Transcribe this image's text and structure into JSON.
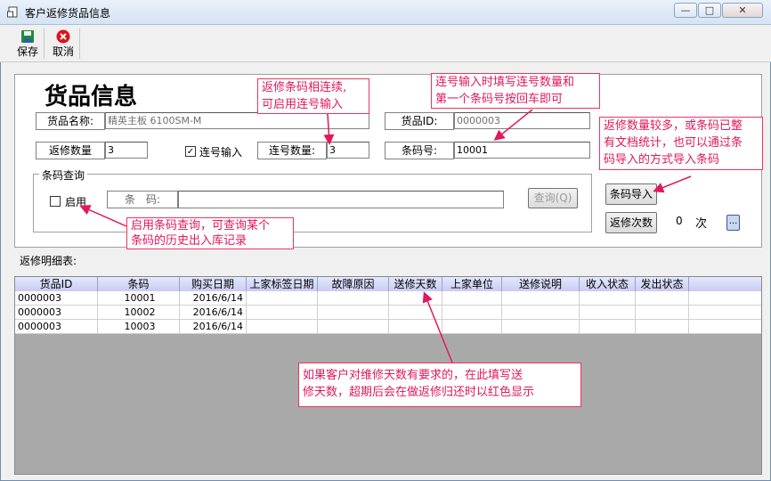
{
  "window": {
    "title": "客户返修货品信息",
    "minimize": "—",
    "maximize": "□",
    "close": "✕"
  },
  "toolbar": {
    "save_label": "保存",
    "cancel_label": "取消"
  },
  "form": {
    "heading": "货品信息",
    "product_name_label": "货品名称:",
    "product_name_value": "精英主板 6100SM-M",
    "product_id_label": "货品ID:",
    "product_id_value": "0000003",
    "repair_qty_label": "返修数量",
    "repair_qty_value": "3",
    "serial_input_label": "连号输入",
    "serial_qty_label": "连号数量:",
    "serial_qty_value": "3",
    "barcode_label": "条码号:",
    "barcode_value": "10001",
    "barcode_query_title": "条码查询",
    "enable_label": "启用",
    "query_barcode_label": "条　码:",
    "query_barcode_value": "",
    "query_button": "查询(Q)",
    "barcode_import_button": "条码导入",
    "repair_times_button": "返修次数",
    "repair_times_value": "0",
    "repair_times_unit": "次",
    "more_button": "..."
  },
  "notes": {
    "n1_line1": "返修条码相连续,",
    "n1_line2": "可启用连号输入",
    "n2_line1": "连号输入时填写连号数量和",
    "n2_line2": "第一个条码号按回车即可",
    "n3_line1": "返修数量较多，或条码已整",
    "n3_line2": "有文档统计，也可以通过条",
    "n3_line3": "码导入的方式导入条码",
    "n4_line1": "启用条码查询，可查询某个",
    "n4_line2": "条码的历史出入库记录",
    "n5_line1": "如果客户对维修天数有要求的，在此填写送",
    "n5_line2": "修天数，超期后会在做返修归还时以红色显示"
  },
  "detail": {
    "label": "返修明细表:",
    "columns": [
      "货品ID",
      "条码",
      "购买日期",
      "上家标签日期",
      "故障原因",
      "送修天数",
      "上家单位",
      "送修说明",
      "收入状态",
      "发出状态"
    ],
    "rows": [
      [
        "0000003",
        "10001",
        "2016/6/14",
        "",
        "",
        "",
        "",
        "",
        "",
        ""
      ],
      [
        "0000003",
        "10002",
        "2016/6/14",
        "",
        "",
        "",
        "",
        "",
        "",
        ""
      ],
      [
        "0000003",
        "10003",
        "2016/6/14",
        "",
        "",
        "",
        "",
        "",
        "",
        ""
      ]
    ]
  },
  "icons": {
    "app": "document-icon",
    "save": "floppy-disk-icon",
    "cancel": "red-x-circle-icon"
  },
  "colors": {
    "note_text": "#e3175c",
    "grid_background": "#a9a9a9",
    "header": "#c9ccf0"
  }
}
